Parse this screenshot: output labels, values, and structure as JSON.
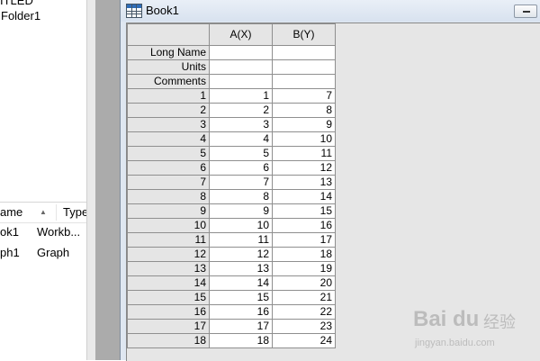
{
  "explorer": {
    "root_label": "ITLED",
    "folder_label": "Folder1",
    "list_header": {
      "name": "ame",
      "type": "Type"
    },
    "items": [
      {
        "name": "ok1",
        "type": "Workb..."
      },
      {
        "name": "ph1",
        "type": "Graph"
      }
    ]
  },
  "book": {
    "title": "Book1",
    "header_rows": [
      "Long Name",
      "Units",
      "Comments"
    ],
    "columns": [
      "A(X)",
      "B(Y)"
    ],
    "rows": [
      {
        "n": "1",
        "a": "1",
        "b": "7"
      },
      {
        "n": "2",
        "a": "2",
        "b": "8"
      },
      {
        "n": "3",
        "a": "3",
        "b": "9"
      },
      {
        "n": "4",
        "a": "4",
        "b": "10"
      },
      {
        "n": "5",
        "a": "5",
        "b": "11"
      },
      {
        "n": "6",
        "a": "6",
        "b": "12"
      },
      {
        "n": "7",
        "a": "7",
        "b": "13"
      },
      {
        "n": "8",
        "a": "8",
        "b": "14"
      },
      {
        "n": "9",
        "a": "9",
        "b": "15"
      },
      {
        "n": "10",
        "a": "10",
        "b": "16"
      },
      {
        "n": "11",
        "a": "11",
        "b": "17"
      },
      {
        "n": "12",
        "a": "12",
        "b": "18"
      },
      {
        "n": "13",
        "a": "13",
        "b": "19"
      },
      {
        "n": "14",
        "a": "14",
        "b": "20"
      },
      {
        "n": "15",
        "a": "15",
        "b": "21"
      },
      {
        "n": "16",
        "a": "16",
        "b": "22"
      },
      {
        "n": "17",
        "a": "17",
        "b": "23"
      },
      {
        "n": "18",
        "a": "18",
        "b": "24"
      }
    ]
  },
  "watermark": {
    "main": "Bai du",
    "cn": "经验",
    "sub": "jingyan.baidu.com"
  },
  "colors": {
    "meta_row": "#fffdc4",
    "mdi_background": "#ababab",
    "header_gray": "#e5e5e5"
  }
}
